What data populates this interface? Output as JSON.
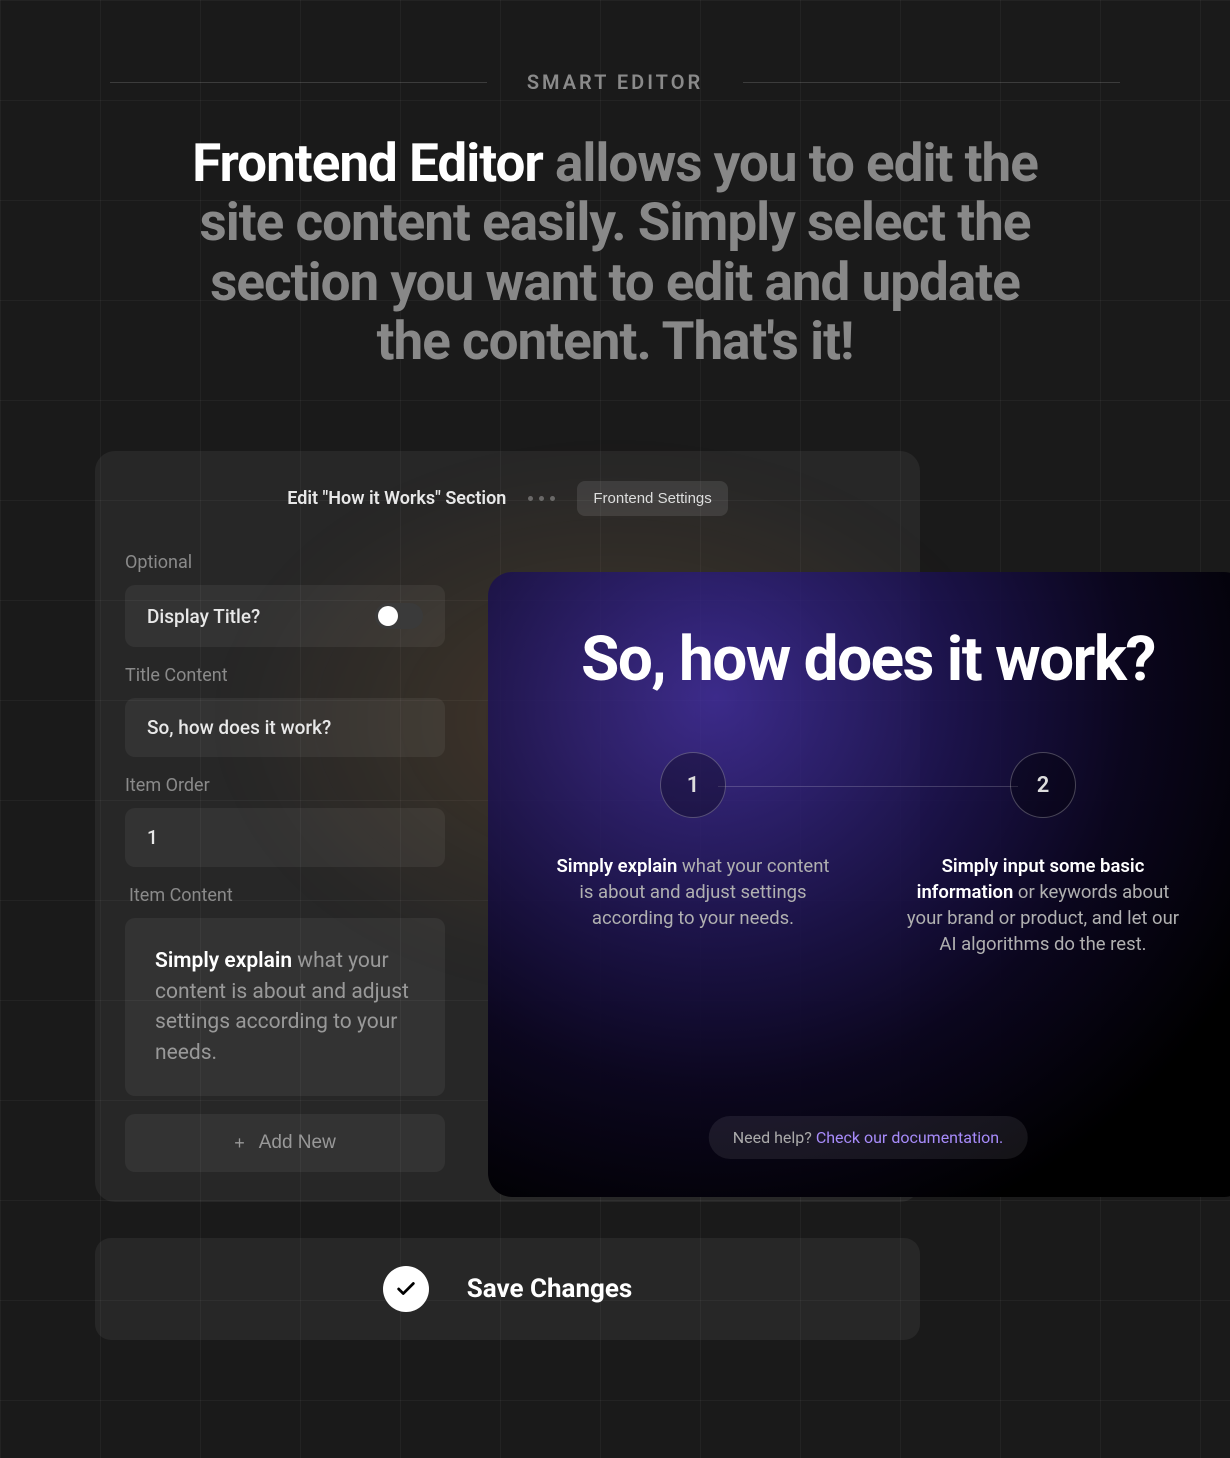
{
  "eyebrow": "SMART EDITOR",
  "headline_bold": "Frontend Editor",
  "headline_rest": " allows you to edit the site content easily. Simply select the section you want to edit and update the content. That's it!",
  "editor": {
    "section_title": "Edit \"How it Works\" Section",
    "settings_button": "Frontend Settings",
    "optional_label": "Optional",
    "display_title_label": "Display Title?",
    "display_title_on": false,
    "title_content_label": "Title Content",
    "title_content_value": "So, how does it work?",
    "item_order_label": "Item Order",
    "item_order_value": "1",
    "item_content_label": "Item Content",
    "item_content_bold": "Simply explain",
    "item_content_rest": " what your content is about and adjust settings according to your needs.",
    "add_new_label": "Add New"
  },
  "preview": {
    "title": "So, how does it work?",
    "steps": [
      {
        "num": "1",
        "bold": "Simply explain",
        "rest": " what your content is about and adjust settings according to your needs."
      },
      {
        "num": "2",
        "bold": "Simply input some basic information",
        "rest": " or keywords about your brand or product, and let our AI algorithms do the rest."
      }
    ],
    "help_prefix": "Need help? ",
    "help_link": "Check our documentation."
  },
  "save_label": "Save Changes"
}
